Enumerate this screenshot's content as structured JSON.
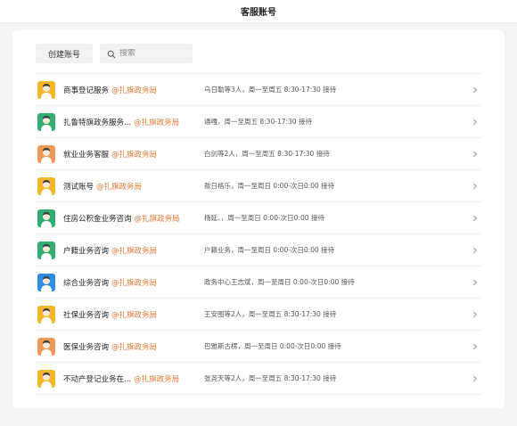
{
  "header": {
    "title": "客服账号"
  },
  "toolbar": {
    "create_label": "创建账号",
    "search_placeholder": "搜索"
  },
  "accounts": [
    {
      "name": "商事登记服务",
      "org": "@扎旗政务局",
      "desc": "乌日勒等3人，周一至周五 8:30-17:30 接待",
      "avatar": "yellow"
    },
    {
      "name": "扎鲁特旗政务服务...",
      "org": "@扎旗政务局",
      "desc": "通嘎，周一至周五 8:30-17:30 接待",
      "avatar": "green"
    },
    {
      "name": "就业业务客服",
      "org": "@扎旗政务局",
      "desc": "白剑等2人，周一至周五 8:30-17:30 接待",
      "avatar": "orange"
    },
    {
      "name": "测试账号",
      "org": "@扎旗政务局",
      "desc": "敖日格乐，周一至周日 0:00-次日0:00 接待",
      "avatar": "yellow"
    },
    {
      "name": "住房公积金业务咨询",
      "org": "@扎旗政务局",
      "desc": "杨延、，周一至周日 0:00-次日0:00 接待",
      "avatar": "green"
    },
    {
      "name": "户籍业务咨询",
      "org": "@扎旗政务局",
      "desc": "户籍业务，周一至周日 0:00-次日0:00 接待",
      "avatar": "green"
    },
    {
      "name": "综合业务咨询",
      "org": "@扎旗政务局",
      "desc": "政务中心王志斌，周一至周日 0:00-次日0:00 接待",
      "avatar": "blue"
    },
    {
      "name": "社保业务咨询",
      "org": "@扎旗政务局",
      "desc": "王安图等2人，周一至周五 8:30-17:30 接待",
      "avatar": "yellow"
    },
    {
      "name": "医保业务咨询",
      "org": "@扎旗政务局",
      "desc": "巴雅斯古楞，周一至周日 0:00-次日0:00 接待",
      "avatar": "orange"
    },
    {
      "name": "不动产登记业务在...",
      "org": "@扎旗政务局",
      "desc": "张尧天等2人，周一至周五 8:30-17:30 接待",
      "avatar": "yellow"
    }
  ],
  "avatar_colors": {
    "yellow": "#f2b82a",
    "green": "#2fae70",
    "orange": "#f09a5a",
    "blue": "#2d8ce4"
  },
  "icons": {
    "search": "search-icon",
    "chevron": "chevron-right-icon",
    "avatar": "person-icon"
  }
}
